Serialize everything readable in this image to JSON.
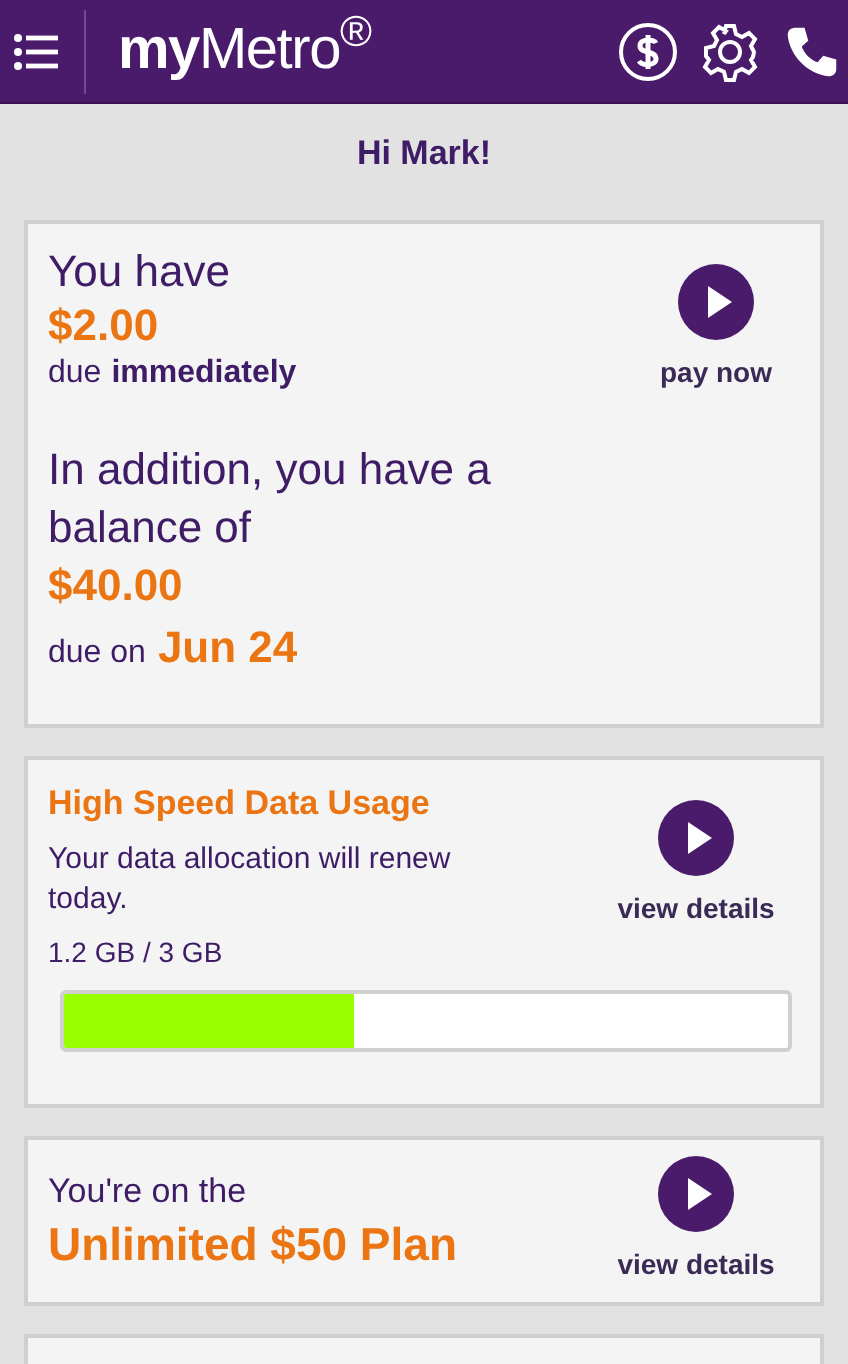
{
  "header": {
    "logo": "**my**Metro$^{®}$"
  },
  "greeting": "Hi Mark!",
  "payment_card": {
    "line_1": "You have",
    "amount_due": "$2.00",
    "due_label": "due",
    "due_when": "immediately",
    "line_2": "In addition, you have a balance of",
    "balance": "$40.00",
    "balance_due_label": "due on",
    "balance_due_date": "Jun 24",
    "action": "pay now"
  },
  "data_card": {
    "title": "High Speed Data Usage",
    "message": "Your data allocation will renew today.",
    "usage": "1.2 GB / 3 GB",
    "level": 0.4,
    "action": "view details"
  },
  "plan_card": {
    "line_1": "You're on the",
    "plan": "Unlimited $50 Plan",
    "action": "view details"
  }
}
